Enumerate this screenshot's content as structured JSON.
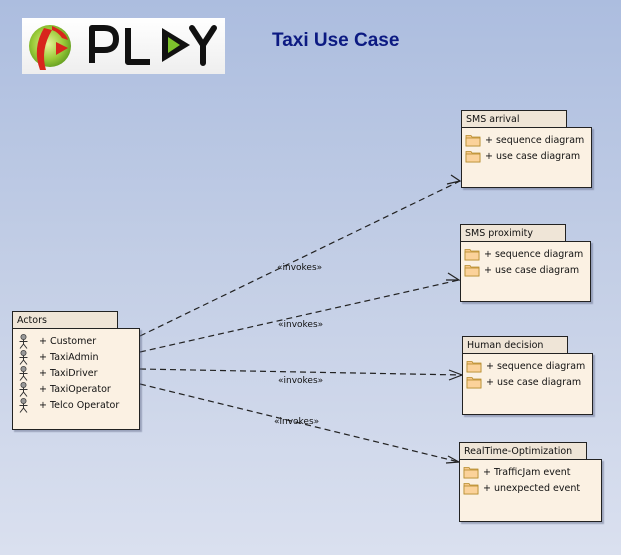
{
  "logo": {
    "text": "PLAY",
    "icon": "play-logo-icon"
  },
  "title": "Taxi Use Case",
  "actors_package": {
    "name": "Actors",
    "items": [
      "+ Customer",
      "+ TaxiAdmin",
      "+ TaxiDriver",
      "+ TaxiOperator",
      "+ Telco Operator"
    ],
    "item_icon": "actor-icon"
  },
  "packages": [
    {
      "name": "SMS arrival",
      "items": [
        "+ sequence diagram",
        "+ use case diagram"
      ],
      "item_icon": "folder-icon"
    },
    {
      "name": "SMS proximity",
      "items": [
        "+ sequence diagram",
        "+ use case diagram"
      ],
      "item_icon": "folder-icon"
    },
    {
      "name": "Human decision",
      "items": [
        "+ sequence diagram",
        "+ use case diagram"
      ],
      "item_icon": "folder-icon"
    },
    {
      "name": "RealTime-Optimization",
      "items": [
        "+ TrafficJam event",
        "+ unexpected event"
      ],
      "item_icon": "folder-icon"
    }
  ],
  "edges": [
    {
      "from": "Actors",
      "to": "SMS arrival",
      "label": "«invokes»"
    },
    {
      "from": "Actors",
      "to": "SMS proximity",
      "label": "«invokes»"
    },
    {
      "from": "Actors",
      "to": "Human decision",
      "label": "«invokes»"
    },
    {
      "from": "Actors",
      "to": "RealTime-Optimization",
      "label": "«invokes»"
    }
  ],
  "colors": {
    "title": "#0c1a82",
    "package_fill": "#fbf1e3",
    "package_tab": "#efe5d7"
  }
}
